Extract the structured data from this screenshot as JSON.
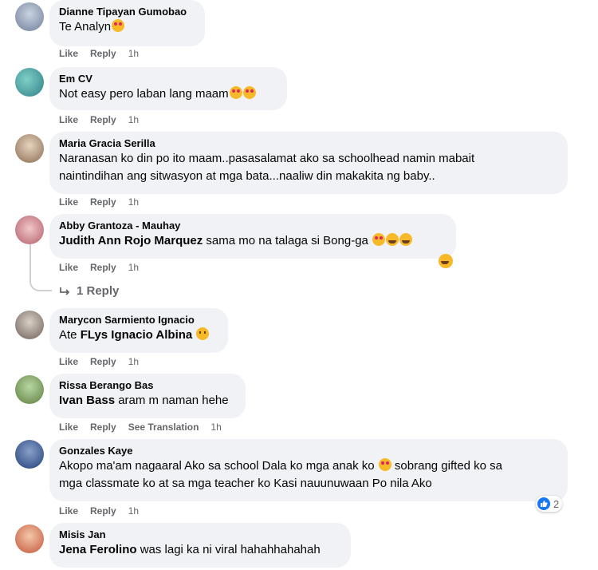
{
  "actions": {
    "like": "Like",
    "reply": "Reply",
    "see_translation": "See Translation"
  },
  "comments": [
    {
      "author": "Dianne Tipayan Gumobao",
      "text": "Te Analyn",
      "time": "1h"
    },
    {
      "author": "Em CV",
      "text": "Not easy pero laban lang maam",
      "time": "1h"
    },
    {
      "author": "Maria Gracia Serilla",
      "line1": "Naranasan ko din po ito maam..pasasalamat ako sa schoolhead namin mabait",
      "line2": "naintindihan ang sitwasyon at mga bata...naaliw din makakita ng baby..",
      "time": "1h"
    },
    {
      "author": "Abby Grantoza - Mauhay",
      "mention": "Judith Ann Rojo Marquez",
      "text": " sama mo na talaga si Bong-ga",
      "time": "1h",
      "replies_label": "1 Reply"
    },
    {
      "author": "Marycon Sarmiento Ignacio",
      "prefix": "Ate ",
      "mention": "FLys Ignacio Albina",
      "time": "1h"
    },
    {
      "author": "Rissa Berango Bas",
      "mention": "Ivan Bass",
      "text": " aram m naman hehe",
      "time": "1h"
    },
    {
      "author": "Gonzales Kaye",
      "line1": "Akopo ma'am nagaaral Ako sa school Dala ko mga anak ko",
      "line1b": " sobrang gifted ko sa",
      "line2": "mga classmate ko at sa mga teacher ko Kasi nauunuwaan Po nila Ako",
      "time": "1h",
      "reaction_count": "2"
    },
    {
      "author": "Misis Jan",
      "mention": "Jena Ferolino",
      "text": " was lagi ka ni viral hahahhahahah"
    }
  ],
  "colors": {
    "bubble": "#f0f2f5",
    "meta": "#65676b",
    "like_blue": "#1877f2"
  }
}
